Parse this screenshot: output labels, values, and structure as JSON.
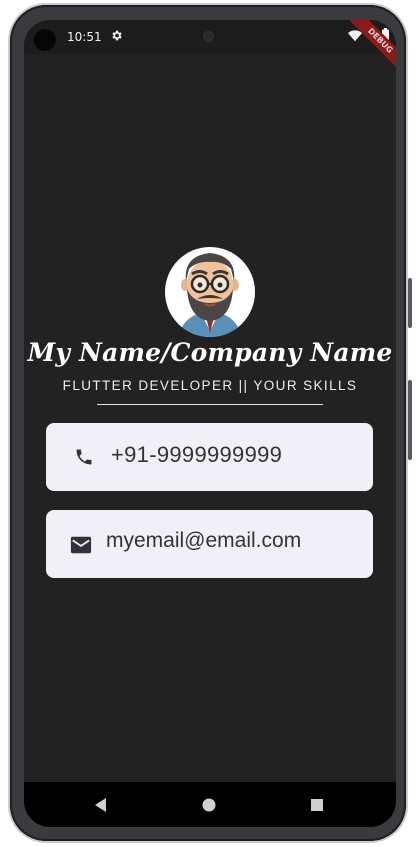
{
  "status_bar": {
    "time": "10:51",
    "icons": [
      "settings-icon",
      "wifi-icon",
      "battery-icon"
    ]
  },
  "debug_banner": "DEBUG",
  "profile": {
    "name": "My Name/Company Name",
    "subtitle": "FLUTTER DEVELOPER || YOUR SKILLS"
  },
  "contacts": [
    {
      "icon": "phone-icon",
      "value": "+91-9999999999"
    },
    {
      "icon": "mail-icon",
      "value": "myemail@email.com"
    }
  ],
  "navigation": {
    "buttons": [
      "back-icon",
      "home-icon",
      "recents-icon"
    ]
  },
  "colors": {
    "background": "#222222",
    "card": "#f1f0f6",
    "text_primary": "#ffffff",
    "debug_banner": "#8b1a1a"
  }
}
